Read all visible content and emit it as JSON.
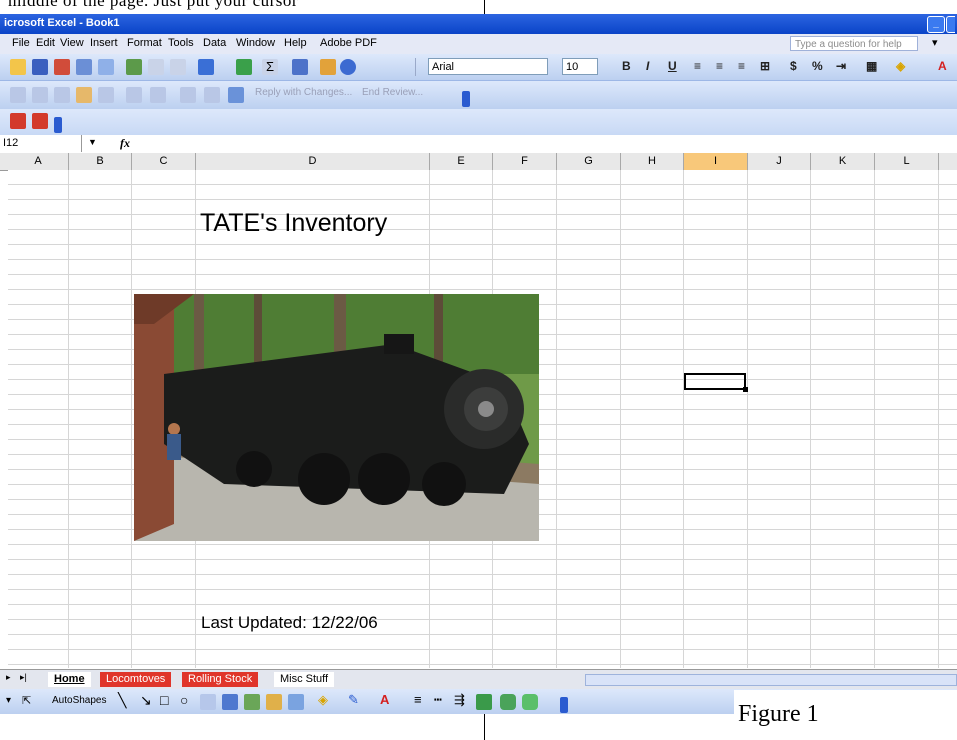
{
  "doc_header_text": "middle of the page. Just put your cursor",
  "window": {
    "title": "icrosoft Excel - Book1"
  },
  "menu": [
    "File",
    "Edit",
    "View",
    "Insert",
    "Format",
    "Tools",
    "Data",
    "Window",
    "Help",
    "Adobe PDF"
  ],
  "help_placeholder": "Type a question for help",
  "toolbar": {
    "font_name": "Arial",
    "font_size": "10"
  },
  "review_bar": {
    "reply_label": "Reply with Changes...",
    "end_review_label": "End Review..."
  },
  "formula_bar": {
    "name_box": "I12",
    "fx_label": "fx",
    "formula": ""
  },
  "columns": [
    {
      "label": "A",
      "selected": false
    },
    {
      "label": "B",
      "selected": false
    },
    {
      "label": "C",
      "selected": false
    },
    {
      "label": "D",
      "selected": false
    },
    {
      "label": "E",
      "selected": false
    },
    {
      "label": "F",
      "selected": false
    },
    {
      "label": "G",
      "selected": false
    },
    {
      "label": "H",
      "selected": false
    },
    {
      "label": "I",
      "selected": true
    },
    {
      "label": "J",
      "selected": false
    },
    {
      "label": "K",
      "selected": false
    },
    {
      "label": "L",
      "selected": false
    }
  ],
  "sheet": {
    "title": "TATE's Inventory",
    "last_updated": "Last Updated: 12/22/06"
  },
  "selected_cell": "I12",
  "tabs": [
    {
      "label": "Home",
      "active": true
    },
    {
      "label": "Locomtoves",
      "color": "#e0352a"
    },
    {
      "label": "Rolling Stock",
      "color": "#e0352a"
    },
    {
      "label": "Misc Stuff"
    }
  ],
  "drawing": {
    "autoshapes_label": "AutoShapes"
  },
  "caption": "Figure 1",
  "colors": {
    "title_bar": "#0a44c8",
    "toolbar": "#c8d9f5",
    "selected_header": "#f8c87a",
    "tab_red": "#e0352a"
  }
}
